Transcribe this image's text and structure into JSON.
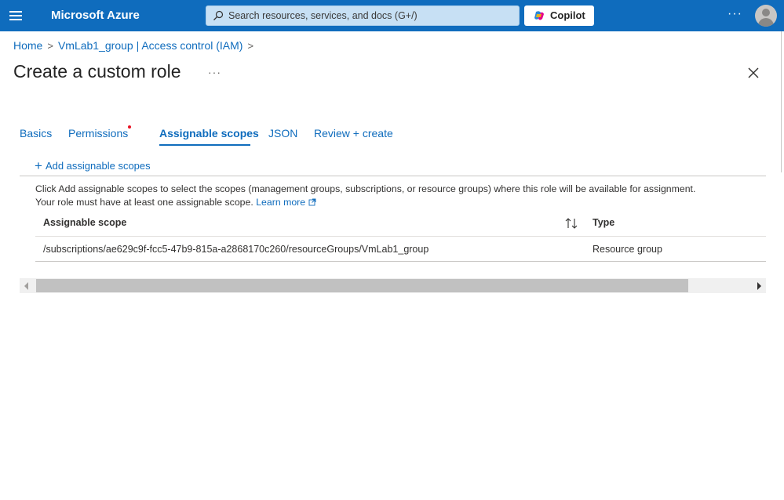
{
  "topbar": {
    "brand": "Microsoft Azure",
    "search_placeholder": "Search resources, services, and docs (G+/)",
    "copilot_label": "Copilot",
    "more_label": "···",
    "accent": "#0f6cbd"
  },
  "breadcrumb": {
    "items": [
      "Home",
      "VmLab1_group | Access control (IAM)"
    ],
    "separator": ">"
  },
  "page": {
    "title": "Create a custom role",
    "more_label": "···"
  },
  "tabs": [
    {
      "label": "Basics"
    },
    {
      "label": "Permissions"
    },
    {
      "label": "Assignable scopes",
      "active": true
    },
    {
      "label": "JSON"
    },
    {
      "label": "Review + create"
    }
  ],
  "actions": {
    "add_scopes": "Add assignable scopes"
  },
  "description": {
    "line1": "Click Add assignable scopes to select the scopes (management groups, subscriptions, or resource groups) where this role will be available for assignment.",
    "line2": "Your role must have at least one assignable scope.",
    "learn_more": "Learn more"
  },
  "table": {
    "headers": {
      "scope": "Assignable scope",
      "type": "Type"
    },
    "rows": [
      {
        "scope": "/subscriptions/ae629c9f-fcc5-47b9-815a-a2868170c260/resourceGroups/VmLab1_group",
        "type": "Resource group"
      }
    ]
  },
  "icons": {
    "menu": "hamburger-icon",
    "search": "search-icon",
    "copilot": "copilot-icon",
    "avatar": "avatar",
    "close": "close-icon",
    "sort": "sort-icon",
    "external": "external-link-icon",
    "add": "plus-icon"
  }
}
